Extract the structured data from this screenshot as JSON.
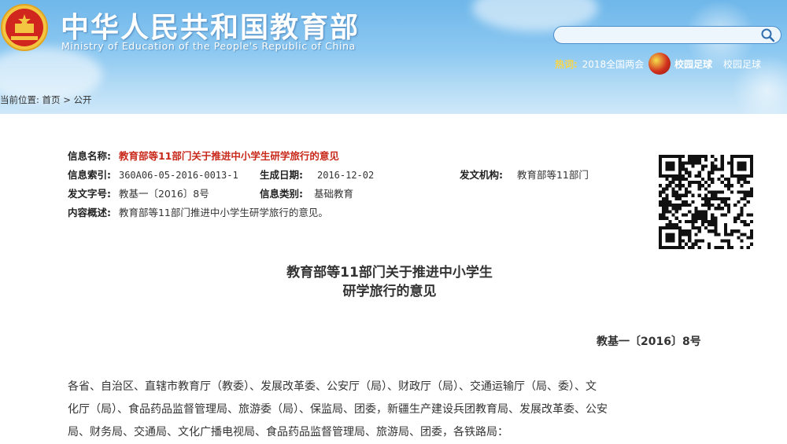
{
  "header": {
    "site_title": "中华人民共和国教育部",
    "site_subtitle": "Ministry of Education of the People's Republic of China",
    "search": {
      "placeholder": "",
      "value": ""
    },
    "hot_label": "热词:",
    "hot_items": [
      "2018全国两会"
    ],
    "campus_football_bold": "校园足球",
    "campus_football_link": "校园足球"
  },
  "breadcrumb": {
    "prefix": "当前位置:",
    "home": "首页",
    "separator": ">",
    "current": "公开"
  },
  "info": {
    "name_label": "信息名称:",
    "name_value": "教育部等11部门关于推进中小学生研学旅行的意见",
    "index_label": "信息索引:",
    "index_value": "360A06-05-2016-0013-1",
    "date_label": "生成日期:",
    "date_value": "2016-12-02",
    "org_label": "发文机构:",
    "org_value": "教育部等11部门",
    "docno_label": "发文字号:",
    "docno_value": "教基一〔2016〕8号",
    "category_label": "信息类别:",
    "category_value": "基础教育",
    "summary_label": "内容概述:",
    "summary_value": "教育部等11部门推进中小学生研学旅行的意见。"
  },
  "article": {
    "title_line1": "教育部等11部门关于推进中小学生",
    "title_line2": "研学旅行的意见",
    "doc_number": "教基一〔2016〕8号",
    "para_lines": [
      "各省、自治区、直辖市教育厅（教委）、发展改革委、公安厅（局）、财政厅（局）、交通运输厅（局、委）、文",
      "化厅（局）、食品药品监督管理局、旅游委（局）、保监局、团委，新疆生产建设兵团教育局、发展改革委、公安",
      "局、财务局、交通局、文化广播电视局、食品药品监督管理局、旅游局、团委，各铁路局："
    ]
  },
  "colors": {
    "header_top": "#6fb7ea",
    "header_bottom": "#cfe8f9",
    "accent_red": "#c8291b",
    "hot_yellow": "#f7d54a"
  },
  "icons": [
    "national-emblem-icon",
    "search-icon",
    "football-icon",
    "qr-code"
  ]
}
